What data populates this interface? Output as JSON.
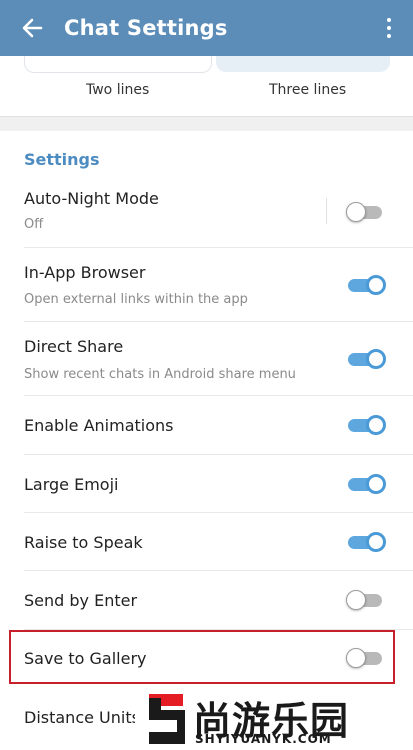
{
  "header": {
    "title": "Chat Settings",
    "back_icon": "arrow-left-icon",
    "menu_icon": "more-vertical-icon",
    "color": "#5b8db8"
  },
  "preview": {
    "options": [
      "Two lines",
      "Three lines"
    ]
  },
  "settings": {
    "section_title": "Settings",
    "accent": "#4d8cc1",
    "items": [
      {
        "label": "Auto-Night Mode",
        "value": "Off",
        "toggle": false
      },
      {
        "label": "In-App Browser",
        "desc": "Open external links within the app",
        "toggle": true
      },
      {
        "label": "Direct Share",
        "desc": "Show recent chats in Android share menu",
        "toggle": true
      },
      {
        "label": "Enable Animations",
        "toggle": true
      },
      {
        "label": "Large Emoji",
        "toggle": true
      },
      {
        "label": "Raise to Speak",
        "toggle": true
      },
      {
        "label": "Send by Enter",
        "toggle": false
      },
      {
        "label": "Save to Gallery",
        "toggle": false
      },
      {
        "label": "Distance Units"
      }
    ]
  },
  "watermark": {
    "text": "尚游乐园",
    "url": "SHYIYUANYK.COM"
  }
}
